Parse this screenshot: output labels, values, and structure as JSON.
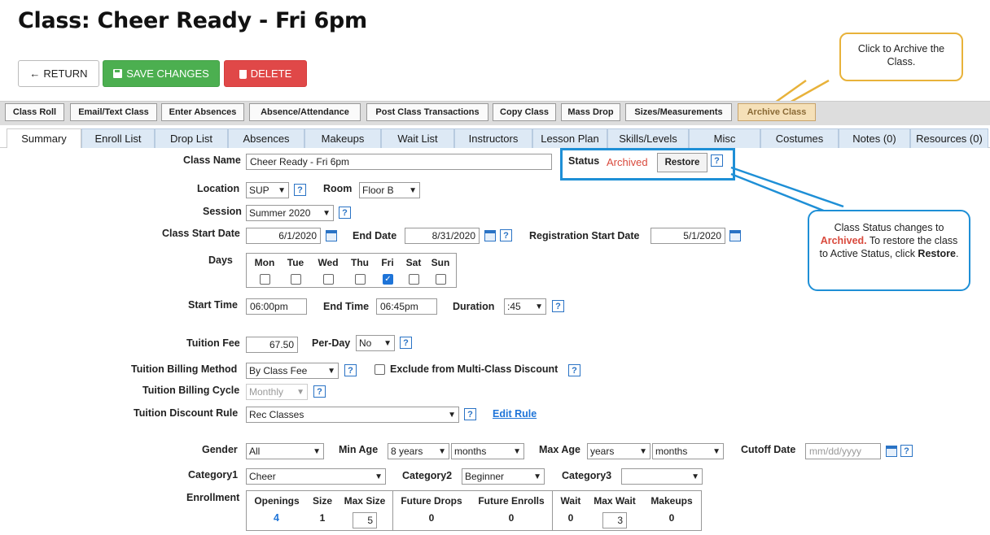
{
  "page": {
    "title": "Class: Cheer Ready - Fri 6pm"
  },
  "buttons": {
    "return": "RETURN",
    "save": "SAVE CHANGES",
    "delete": "DELETE"
  },
  "toolbar": [
    "Class Roll",
    "Email/Text Class",
    "Enter Absences",
    "Absence/Attendance",
    "Post Class Transactions",
    "Copy Class",
    "Mass Drop",
    "Sizes/Measurements",
    "Archive Class"
  ],
  "tabs": [
    "Summary",
    "Enroll List",
    "Drop List",
    "Absences",
    "Makeups",
    "Wait List",
    "Instructors",
    "Lesson Plan",
    "Skills/Levels",
    "Misc",
    "Costumes",
    "Notes (0)",
    "Resources (0)"
  ],
  "callouts": {
    "archive": "Click to Archive the Class.",
    "status_a": "Class Status changes to ",
    "status_b": "Archived.",
    "status_c": " To restore the class to Active Status, click ",
    "status_d": "Restore",
    "status_e": "."
  },
  "form": {
    "class_name_label": "Class Name",
    "class_name": "Cheer Ready  - Fri 6pm",
    "status_label": "Status",
    "status": "Archived",
    "restore": "Restore",
    "location_label": "Location",
    "location": "SUP",
    "room_label": "Room",
    "room": "Floor B",
    "session_label": "Session",
    "session": "Summer 2020",
    "start_date_label": "Class Start Date",
    "start_date": "6/1/2020",
    "end_date_label": "End Date",
    "end_date": "8/31/2020",
    "reg_start_label": "Registration Start Date",
    "reg_start": "5/1/2020",
    "days_label": "Days",
    "days": [
      "Mon",
      "Tue",
      "Wed",
      "Thu",
      "Fri",
      "Sat",
      "Sun"
    ],
    "days_checked": [
      false,
      false,
      false,
      false,
      true,
      false,
      false
    ],
    "start_time_label": "Start Time",
    "start_time": "06:00pm",
    "end_time_label": "End Time",
    "end_time": "06:45pm",
    "duration_label": "Duration",
    "duration": ":45",
    "tuition_fee_label": "Tuition Fee",
    "tuition_fee": "67.50",
    "per_day_label": "Per-Day",
    "per_day": "No",
    "billing_method_label": "Tuition Billing Method",
    "billing_method": "By Class Fee",
    "exclude_label": "Exclude from Multi-Class Discount",
    "billing_cycle_label": "Tuition Billing Cycle",
    "billing_cycle": "Monthly",
    "discount_rule_label": "Tuition Discount Rule",
    "discount_rule": "Rec Classes",
    "edit_rule": "Edit Rule",
    "gender_label": "Gender",
    "gender": "All",
    "min_age_label": "Min Age",
    "min_age_years": "8 years",
    "min_age_months": "months",
    "max_age_label": "Max Age",
    "max_age_years": "years",
    "max_age_months": "months",
    "cutoff_label": "Cutoff Date",
    "cutoff_placeholder": "mm/dd/yyyy",
    "category1_label": "Category1",
    "category1": "Cheer",
    "category2_label": "Category2",
    "category2": "Beginner",
    "category3_label": "Category3",
    "category3": "",
    "enrollment_label": "Enrollment"
  },
  "enrollment": {
    "headers": [
      "Openings",
      "Size",
      "Max Size",
      "Future Drops",
      "Future Enrolls",
      "Wait",
      "Max Wait",
      "Makeups"
    ],
    "openings": "4",
    "size": "1",
    "max_size": "5",
    "future_drops": "0",
    "future_enrolls": "0",
    "wait": "0",
    "max_wait": "3",
    "makeups": "0"
  },
  "colors": {
    "save": "#4caf50",
    "delete": "#e04848",
    "archived": "#d94a3d",
    "link": "#1e74d8",
    "callout_blue": "#1e8fd6",
    "callout_gold": "#e8b23a"
  }
}
